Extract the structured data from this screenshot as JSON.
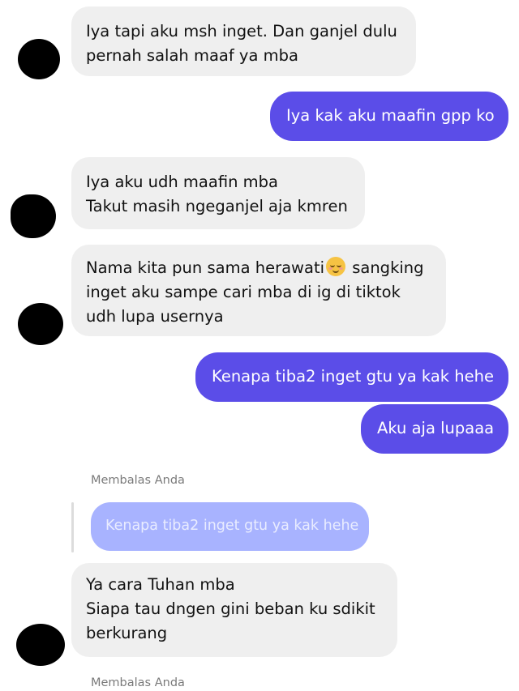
{
  "messages": [
    {
      "id": "m1",
      "side": "in",
      "lines": [
        "Iya tapi aku msh inget. Dan ganjel dulu",
        "pernah salah maaf ya mba"
      ]
    },
    {
      "id": "m2",
      "side": "out",
      "lines": [
        "Iya kak aku maafin gpp ko"
      ]
    },
    {
      "id": "m3",
      "side": "in",
      "lines": [
        "Iya aku udh maafin mba",
        "Takut masih ngeganjel aja kmren"
      ]
    },
    {
      "id": "m4",
      "side": "in",
      "lines": [
        "Nama kita pun sama herawati",
        "sangking",
        "inget aku sampe cari mba di ig di tiktok",
        "udh lupa usernya"
      ],
      "emoji": "smiling-face-icon"
    },
    {
      "id": "m5",
      "side": "out",
      "lines": [
        "Kenapa tiba2 inget gtu ya kak hehe"
      ]
    },
    {
      "id": "m6",
      "side": "out",
      "lines": [
        "Aku aja lupaaa"
      ]
    },
    {
      "id": "m7",
      "side": "in",
      "lines": [
        "Ya cara Tuhan mba",
        "Siapa tau dngen gini beban ku sdikit",
        "berkurang"
      ]
    }
  ],
  "reply_context": [
    {
      "label": "Membalas Anda",
      "quoted": "Kenapa tiba2 inget gtu ya kak hehe"
    },
    {
      "label": "Membalas Anda"
    }
  ],
  "colors": {
    "incoming_bubble": "#efefef",
    "outgoing_bubble": "#5b4de8",
    "quoted_bubble": "#a8b3ff",
    "avatar_redaction": "#000000"
  }
}
